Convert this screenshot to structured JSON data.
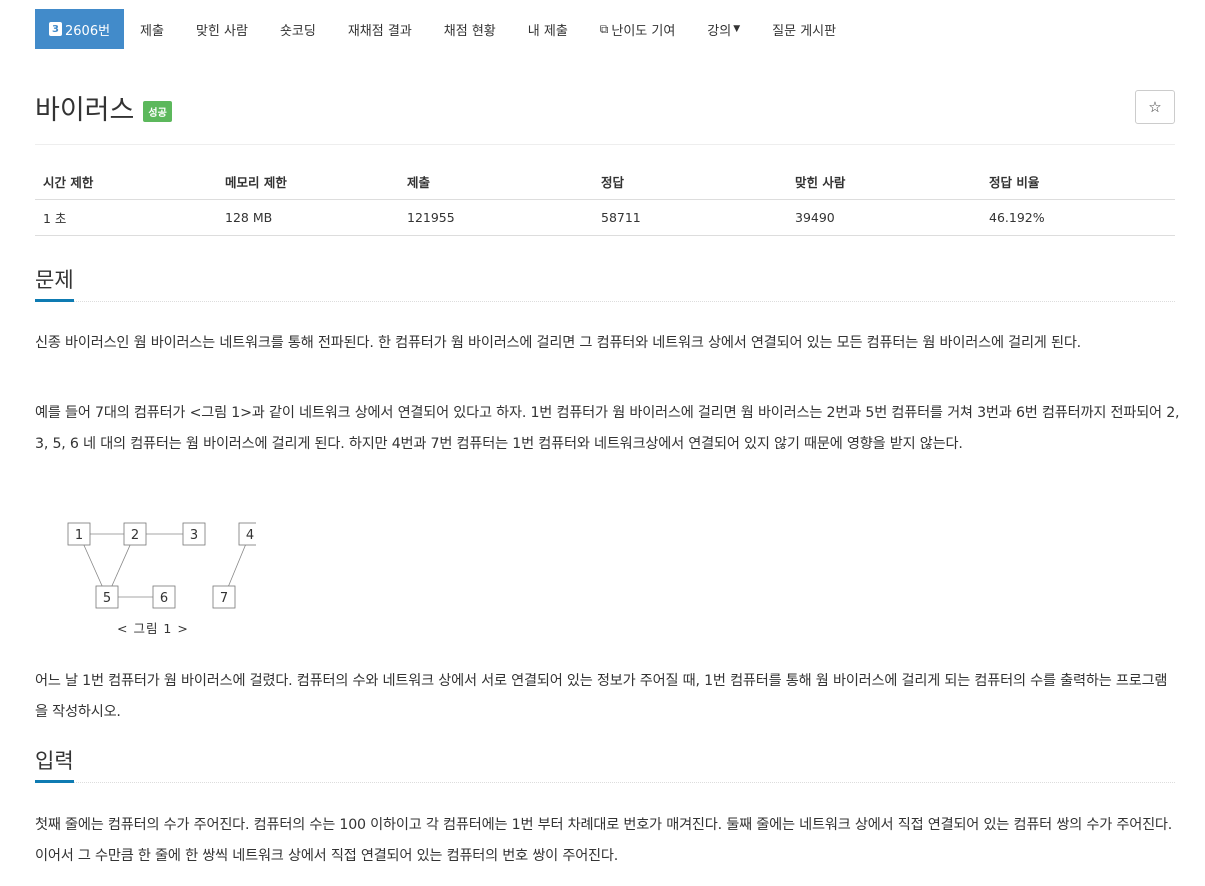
{
  "nav": {
    "problem_tier": "3",
    "problem_number": "2606번",
    "submit": "제출",
    "solved_users": "맞힌 사람",
    "shortest_code": "숏코딩",
    "rejudge_result": "재채점 결과",
    "judge_status": "채점 현황",
    "my_submissions": "내 제출",
    "difficulty": "난이도 기여",
    "lecture": "강의",
    "qna": "질문 게시판"
  },
  "problem": {
    "title": "바이러스",
    "status": "성공"
  },
  "info": {
    "headers": [
      "시간 제한",
      "메모리 제한",
      "제출",
      "정답",
      "맞힌 사람",
      "정답 비율"
    ],
    "values": [
      "1 초",
      "128 MB",
      "121955",
      "58711",
      "39490",
      "46.192%"
    ]
  },
  "sections": {
    "description_title": "문제",
    "input_title": "입력"
  },
  "description": {
    "p1": "신종 바이러스인 웜 바이러스는 네트워크를 통해 전파된다. 한 컴퓨터가 웜 바이러스에 걸리면 그 컴퓨터와 네트워크 상에서 연결되어 있는 모든 컴퓨터는 웜 바이러스에 걸리게 된다.",
    "p2": "예를 들어 7대의 컴퓨터가 <그림 1>과 같이 네트워크 상에서 연결되어 있다고 하자. 1번 컴퓨터가 웜 바이러스에 걸리면 웜 바이러스는 2번과 5번 컴퓨터를 거쳐 3번과 6번 컴퓨터까지 전파되어 2, 3, 5, 6 네 대의 컴퓨터는 웜 바이러스에 걸리게 된다. 하지만 4번과 7번 컴퓨터는 1번 컴퓨터와 네트워크상에서 연결되어 있지 않기 때문에 영향을 받지 않는다.",
    "p3": "어느 날 1번 컴퓨터가 웜 바이러스에 걸렸다. 컴퓨터의 수와 네트워크 상에서 서로 연결되어 있는 정보가 주어질 때, 1번 컴퓨터를 통해 웜 바이러스에 걸리게 되는 컴퓨터의 수를 출력하는 프로그램을 작성하시오."
  },
  "figure": {
    "nodes": [
      "1",
      "2",
      "3",
      "4",
      "5",
      "6",
      "7"
    ],
    "edges": [
      [
        "1",
        "2"
      ],
      [
        "2",
        "3"
      ],
      [
        "1",
        "5"
      ],
      [
        "2",
        "5"
      ],
      [
        "5",
        "6"
      ],
      [
        "4",
        "7"
      ]
    ],
    "caption": "< 그림 1 >"
  },
  "input": {
    "p1": "첫째 줄에는 컴퓨터의 수가 주어진다. 컴퓨터의 수는 100 이하이고 각 컴퓨터에는 1번 부터 차례대로 번호가 매겨진다. 둘째 줄에는 네트워크 상에서 직접 연결되어 있는 컴퓨터 쌍의 수가 주어진다. 이어서 그 수만큼 한 줄에 한 쌍씩 네트워크 상에서 직접 연결되어 있는 컴퓨터의 번호 쌍이 주어진다."
  }
}
